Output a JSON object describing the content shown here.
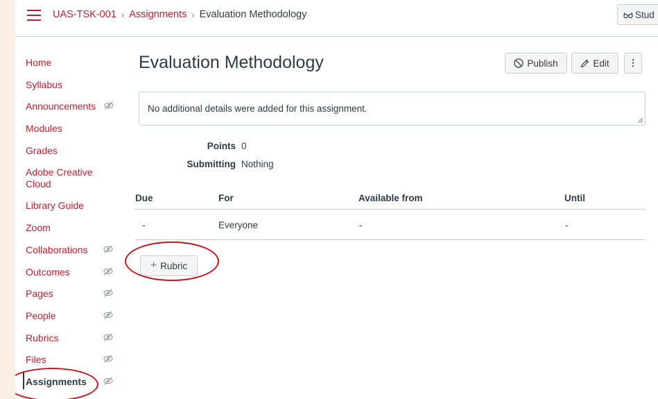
{
  "breadcrumb": {
    "course": "UAS-TSK-001",
    "section": "Assignments",
    "current": "Evaluation Methodology"
  },
  "student_view": {
    "label": "Stud"
  },
  "sidebar": {
    "items": [
      {
        "label": "Home",
        "hidden": false
      },
      {
        "label": "Syllabus",
        "hidden": false
      },
      {
        "label": "Announcements",
        "hidden": true
      },
      {
        "label": "Modules",
        "hidden": false
      },
      {
        "label": "Grades",
        "hidden": false
      },
      {
        "label": "Adobe Creative Cloud",
        "hidden": false
      },
      {
        "label": "Library Guide",
        "hidden": false
      },
      {
        "label": "Zoom",
        "hidden": false
      },
      {
        "label": "Collaborations",
        "hidden": true
      },
      {
        "label": "Outcomes",
        "hidden": true
      },
      {
        "label": "Pages",
        "hidden": true
      },
      {
        "label": "People",
        "hidden": true
      },
      {
        "label": "Rubrics",
        "hidden": true
      },
      {
        "label": "Files",
        "hidden": true
      },
      {
        "label": "Assignments",
        "hidden": true,
        "active": true
      }
    ]
  },
  "assignment": {
    "title": "Evaluation Methodology",
    "description": "No additional details were added for this assignment.",
    "points_label": "Points",
    "points_value": "0",
    "submitting_label": "Submitting",
    "submitting_value": "Nothing"
  },
  "actions": {
    "publish": "Publish",
    "edit": "Edit",
    "more": "⋮"
  },
  "dates_table": {
    "headers": [
      "Due",
      "For",
      "Available from",
      "Until"
    ],
    "rows": [
      [
        "-",
        "Everyone",
        "-",
        "-"
      ]
    ]
  },
  "rubric_button": {
    "label": "Rubric"
  },
  "colors": {
    "accent": "#bf1e2e",
    "text": "#2d3b45",
    "highlight_ring": "#d0101a",
    "border": "#c7cdd1"
  }
}
